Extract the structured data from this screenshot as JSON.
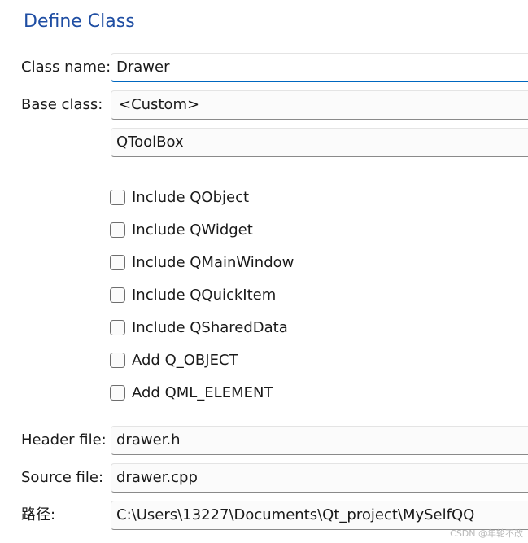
{
  "page_title": "Define Class",
  "class_name": {
    "label": "Class name:",
    "value": "Drawer"
  },
  "base_class": {
    "label": "Base class:",
    "value": "<Custom>",
    "custom_value": "QToolBox"
  },
  "checkboxes": [
    {
      "label": "Include QObject",
      "checked": false
    },
    {
      "label": "Include QWidget",
      "checked": false
    },
    {
      "label": "Include QMainWindow",
      "checked": false
    },
    {
      "label": "Include QQuickItem",
      "checked": false
    },
    {
      "label": "Include QSharedData",
      "checked": false
    },
    {
      "label": "Add Q_OBJECT",
      "checked": false
    },
    {
      "label": "Add QML_ELEMENT",
      "checked": false
    }
  ],
  "header_file": {
    "label": "Header file:",
    "value": "drawer.h"
  },
  "source_file": {
    "label": "Source file:",
    "value": "drawer.cpp"
  },
  "path": {
    "label": "路径:",
    "value": "C:\\Users\\13227\\Documents\\Qt_project\\MySelfQQ"
  },
  "watermark": "CSDN @年轮不改",
  "colors": {
    "title": "#1f4ea3",
    "focus_underline": "#0067c0"
  }
}
